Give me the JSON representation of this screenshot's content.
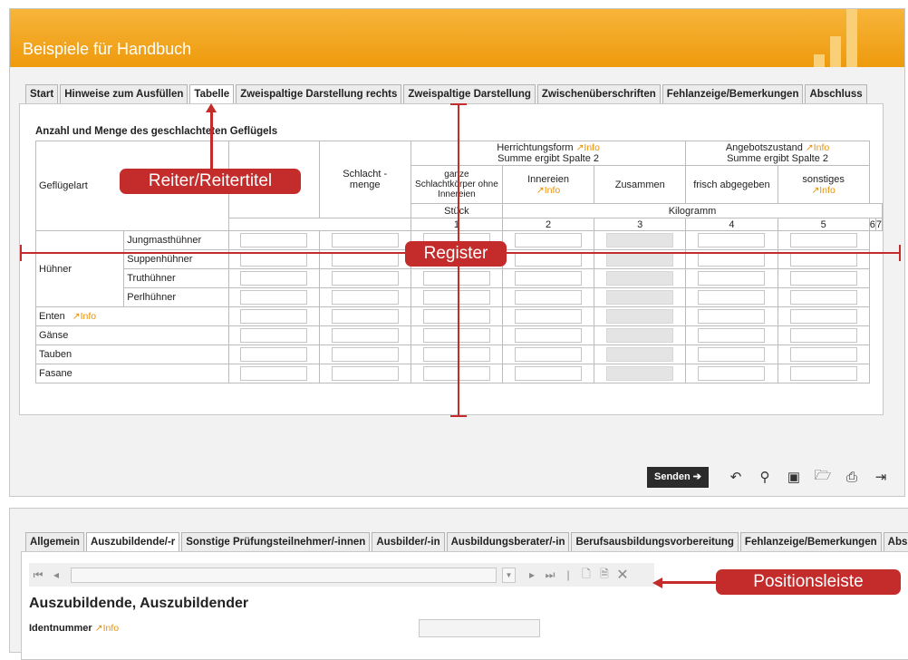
{
  "window1": {
    "title": "Beispiele für Handbuch",
    "tabs": [
      {
        "label": "Start",
        "active": false
      },
      {
        "label": "Hinweise zum Ausfüllen",
        "active": false
      },
      {
        "label": "Tabelle",
        "active": true
      },
      {
        "label": "Zweispaltige Darstellung rechts",
        "active": false
      },
      {
        "label": "Zweispaltige Darstellung",
        "active": false
      },
      {
        "label": "Zwischenüberschriften",
        "active": false
      },
      {
        "label": "Fehlanzeige/Bemerkungen",
        "active": false
      },
      {
        "label": "Abschluss",
        "active": false
      }
    ],
    "table": {
      "title": "Anzahl und Menge des geschlachteten Geflügels",
      "col_label": "Geflügelart",
      "col_schlacht": "Schlacht -\nmenge",
      "group_herr": "Herrichtungsform",
      "group_herr_sub": "Summe ergibt Spalte 2",
      "group_angebot": "Angebotszustand",
      "group_angebot_sub": "Summe ergibt Spalte 2",
      "col_ganze": "ganze Schlachtkörper ohne Innereien",
      "col_innereien": "Innereien",
      "col_zusammen": "Zusammen",
      "col_frisch": "frisch abgegeben",
      "col_sonstiges": "sonstiges",
      "unit_stueck": "Stück",
      "unit_kg": "Kilogramm",
      "col_numbers": [
        "1",
        "2",
        "3",
        "4",
        "5",
        "6",
        "7"
      ],
      "info_label": "Info",
      "group_huehner": "Hühner",
      "sub_rows": [
        "Jungmasthühner",
        "Suppenhühner",
        "Truthühner",
        "Perlhühner"
      ],
      "rows": [
        "Enten",
        "Gänse",
        "Tauben",
        "Fasane"
      ]
    },
    "toolbar": {
      "send_label": "Senden",
      "icons": [
        "undo-icon",
        "search-icon",
        "save-icon",
        "folder-open-icon",
        "print-icon",
        "exit-icon"
      ]
    }
  },
  "annotations": {
    "reiter": "Reiter/Reitertitel",
    "register": "Register",
    "positionsleiste": "Positionsleiste"
  },
  "window2": {
    "tabs": [
      {
        "label": "Allgemein",
        "active": false
      },
      {
        "label": "Auszubildende/-r",
        "active": true
      },
      {
        "label": "Sonstige Prüfungsteilnehmer/-innen",
        "active": false
      },
      {
        "label": "Ausbilder/-in",
        "active": false
      },
      {
        "label": "Ausbildungsberater/-in",
        "active": false
      },
      {
        "label": "Berufsausbildungsvorbereitung",
        "active": false
      },
      {
        "label": "Fehlanzeige/Bemerkungen",
        "active": false
      },
      {
        "label": "Abs",
        "active": false
      }
    ],
    "section_title": "Auszubildende, Auszubildender",
    "ident_label": "Identnummer",
    "info_label": "Info"
  },
  "colors": {
    "header_orange": "#f0a11e",
    "annotation_red": "#c42b2b",
    "info_orange": "#e8920d"
  }
}
